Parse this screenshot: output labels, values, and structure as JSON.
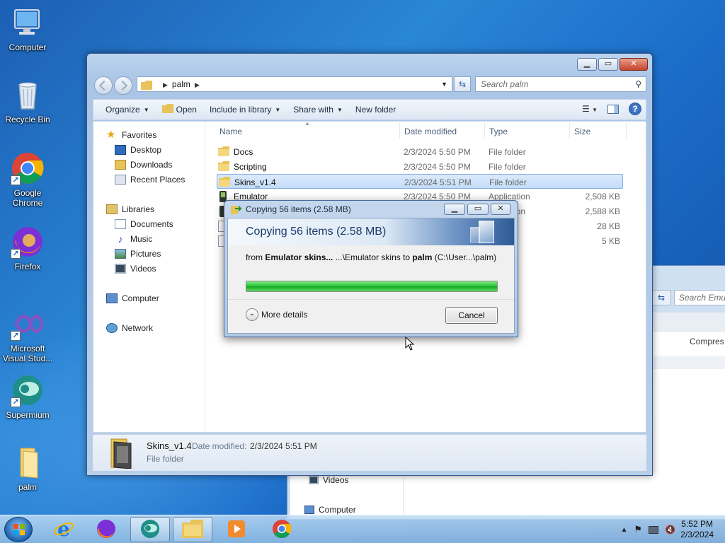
{
  "desktop": {
    "icons": [
      {
        "label": "Computer",
        "icon": "computer-icon"
      },
      {
        "label": "Recycle Bin",
        "icon": "recycle-bin-icon"
      },
      {
        "label": "Google Chrome",
        "icon": "chrome-icon"
      },
      {
        "label": "Firefox",
        "icon": "firefox-icon"
      },
      {
        "label": "Microsoft Visual Stud...",
        "icon": "visual-studio-icon"
      },
      {
        "label": "Supermium",
        "icon": "supermium-icon"
      },
      {
        "label": "palm",
        "icon": "folder-icon"
      }
    ]
  },
  "bg_window": {
    "search_placeholder": "Search Emul",
    "column": "Compres",
    "nav": [
      {
        "label": "Videos"
      },
      {
        "label": "Computer"
      }
    ]
  },
  "explorer": {
    "address": {
      "folder": "palm"
    },
    "search_placeholder": "Search palm",
    "toolbar": {
      "organize": "Organize",
      "open": "Open",
      "include_in_library": "Include in library",
      "share_with": "Share with",
      "new_folder": "New folder"
    },
    "nav": {
      "favorites": "Favorites",
      "desktop": "Desktop",
      "downloads": "Downloads",
      "recent_places": "Recent Places",
      "libraries": "Libraries",
      "documents": "Documents",
      "music": "Music",
      "pictures": "Pictures",
      "videos": "Videos",
      "computer": "Computer",
      "network": "Network"
    },
    "columns": {
      "name": "Name",
      "date": "Date modified",
      "type": "Type",
      "size": "Size"
    },
    "files": [
      {
        "name": "Docs",
        "date": "2/3/2024 5:50 PM",
        "type": "File folder",
        "size": ""
      },
      {
        "name": "Scripting",
        "date": "2/3/2024 5:50 PM",
        "type": "File folder",
        "size": ""
      },
      {
        "name": "Skins_v1.4",
        "date": "2/3/2024 5:51 PM",
        "type": "File folder",
        "size": ""
      },
      {
        "name": "Emulator",
        "date": "2/3/2024 5:50 PM",
        "type": "Application",
        "size": "2,508 KB"
      },
      {
        "name": "",
        "date": "",
        "type": "ion",
        "size": "2,588 KB"
      },
      {
        "name": "",
        "date": "",
        "type": "",
        "size": "28 KB"
      },
      {
        "name": "",
        "date": "",
        "type": "",
        "size": "5 KB"
      }
    ],
    "details": {
      "name": "Skins_v1.4",
      "date_label": "Date modified:",
      "date_value": "2/3/2024 5:51 PM",
      "type": "File folder"
    }
  },
  "copy_dialog": {
    "title": "Copying 56 items (2.58 MB)",
    "heading": "Copying 56 items (2.58 MB)",
    "from_prefix": "from ",
    "from_source": "Emulator skins...",
    "from_middle": " ...\\Emulator skins to ",
    "from_dest": "palm",
    "from_suffix": " (C:\\User...\\palm)",
    "progress_percent": 100,
    "more_details": "More details",
    "cancel": "Cancel"
  },
  "taskbar": {
    "time": "5:52 PM",
    "date": "2/3/2024",
    "apps": [
      "internet-explorer-icon",
      "firefox-icon",
      "supermium-icon",
      "file-explorer-icon",
      "media-player-icon",
      "chrome-icon"
    ]
  },
  "colors": {
    "progress": "#20c030",
    "selection": "#c3dcf8",
    "title_text": "#1a3a6a"
  }
}
